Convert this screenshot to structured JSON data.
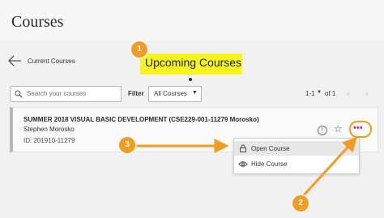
{
  "page": {
    "title": "Courses"
  },
  "nav": {
    "back_label": "Current Courses",
    "current_section": "Upcoming Courses"
  },
  "toolbar": {
    "search_placeholder": "Search your courses",
    "filter_label": "Filter",
    "filter_value": "All Courses",
    "pager_range": "1-1",
    "pager_of": "of 1",
    "prev_glyph": "‹",
    "next_glyph": "›"
  },
  "course": {
    "title": "SUMMER 2018 VISUAL BASIC DEVELOPMENT (CSE229-001-11279 Morosko)",
    "instructor": "Stephen Morosko",
    "id_text": "ID: 201910-11279",
    "more_glyph": "•••"
  },
  "menu": {
    "items": [
      {
        "label": "Open Course",
        "icon": "lock-icon"
      },
      {
        "label": "Hide Course",
        "icon": "eye-icon"
      }
    ]
  },
  "callouts": [
    "1",
    "2",
    "3"
  ],
  "colors": {
    "highlight": "#f7f41e",
    "callout": "#f39c21",
    "more_dots": "#c0379b"
  }
}
